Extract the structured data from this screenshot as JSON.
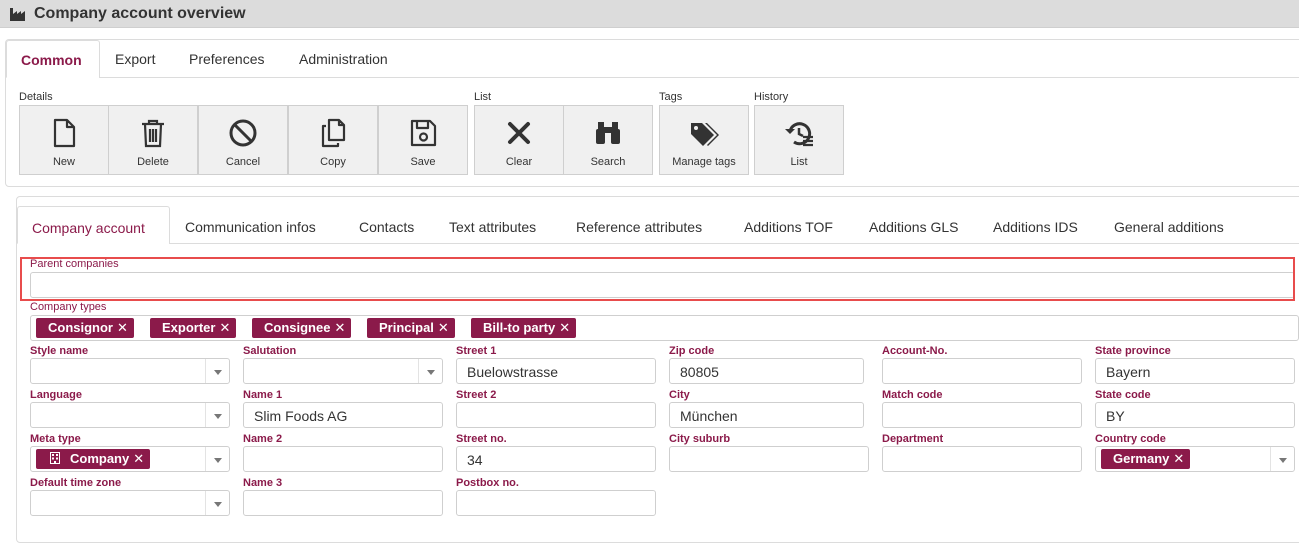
{
  "window": {
    "title": "Company account overview",
    "icon": "factory-icon"
  },
  "main_tabs": [
    {
      "label": "Common",
      "active": true
    },
    {
      "label": "Export",
      "active": false
    },
    {
      "label": "Preferences",
      "active": false
    },
    {
      "label": "Administration",
      "active": false
    }
  ],
  "toolbar": {
    "groups": {
      "details": "Details",
      "list": "List",
      "tags": "Tags",
      "history": "History"
    },
    "buttons": [
      {
        "label": "New",
        "icon": "new-file-icon"
      },
      {
        "label": "Delete",
        "icon": "trash-icon"
      },
      {
        "label": "Cancel",
        "icon": "cancel-icon"
      },
      {
        "label": "Copy",
        "icon": "copy-icon"
      },
      {
        "label": "Save",
        "icon": "save-icon"
      },
      {
        "label": "Clear",
        "icon": "clear-x-icon"
      },
      {
        "label": "Search",
        "icon": "binoculars-icon"
      },
      {
        "label": "Manage tags",
        "icon": "tags-icon"
      },
      {
        "label": "List",
        "icon": "history-list-icon"
      }
    ]
  },
  "sub_tabs": [
    {
      "label": "Company account",
      "active": true
    },
    {
      "label": "Communication infos",
      "active": false
    },
    {
      "label": "Contacts",
      "active": false
    },
    {
      "label": "Text attributes",
      "active": false
    },
    {
      "label": "Reference attributes",
      "active": false
    },
    {
      "label": "Additions TOF",
      "active": false
    },
    {
      "label": "Additions GLS",
      "active": false
    },
    {
      "label": "Additions IDS",
      "active": false
    },
    {
      "label": "General additions",
      "active": false
    }
  ],
  "form": {
    "parent_companies": {
      "label": "Parent companies",
      "value": ""
    },
    "company_types": {
      "label": "Company types",
      "chips": [
        "Consignor",
        "Exporter",
        "Consignee",
        "Principal",
        "Bill-to party"
      ],
      "remove_glyph": "✕"
    },
    "style_name": {
      "label": "Style name",
      "value": ""
    },
    "language": {
      "label": "Language",
      "value": ""
    },
    "meta_type": {
      "label": "Meta type",
      "chip": "Company",
      "chip_icon": "building-icon"
    },
    "default_time_zone": {
      "label": "Default time zone",
      "value": ""
    },
    "salutation": {
      "label": "Salutation",
      "value": ""
    },
    "name1": {
      "label": "Name 1",
      "value": "Slim Foods AG"
    },
    "name2": {
      "label": "Name 2",
      "value": ""
    },
    "name3": {
      "label": "Name 3",
      "value": ""
    },
    "street1": {
      "label": "Street 1",
      "value": "Buelowstrasse"
    },
    "street2": {
      "label": "Street 2",
      "value": ""
    },
    "street_no": {
      "label": "Street no.",
      "value": "34"
    },
    "postbox_no": {
      "label": "Postbox no.",
      "value": ""
    },
    "zip_code": {
      "label": "Zip code",
      "value": "80805"
    },
    "city": {
      "label": "City",
      "value": "München"
    },
    "city_suburb": {
      "label": "City suburb",
      "value": ""
    },
    "account_no": {
      "label": "Account-No.",
      "value": ""
    },
    "match_code": {
      "label": "Match code",
      "value": ""
    },
    "department": {
      "label": "Department",
      "value": ""
    },
    "state_province": {
      "label": "State province",
      "value": "Bayern"
    },
    "state_code": {
      "label": "State code",
      "value": "BY"
    },
    "country_code": {
      "label": "Country code",
      "chip": "Germany"
    }
  },
  "colors": {
    "accent": "#8b1a4a",
    "highlight": "#e84c4c",
    "titlebar": "#dcdcdc"
  }
}
